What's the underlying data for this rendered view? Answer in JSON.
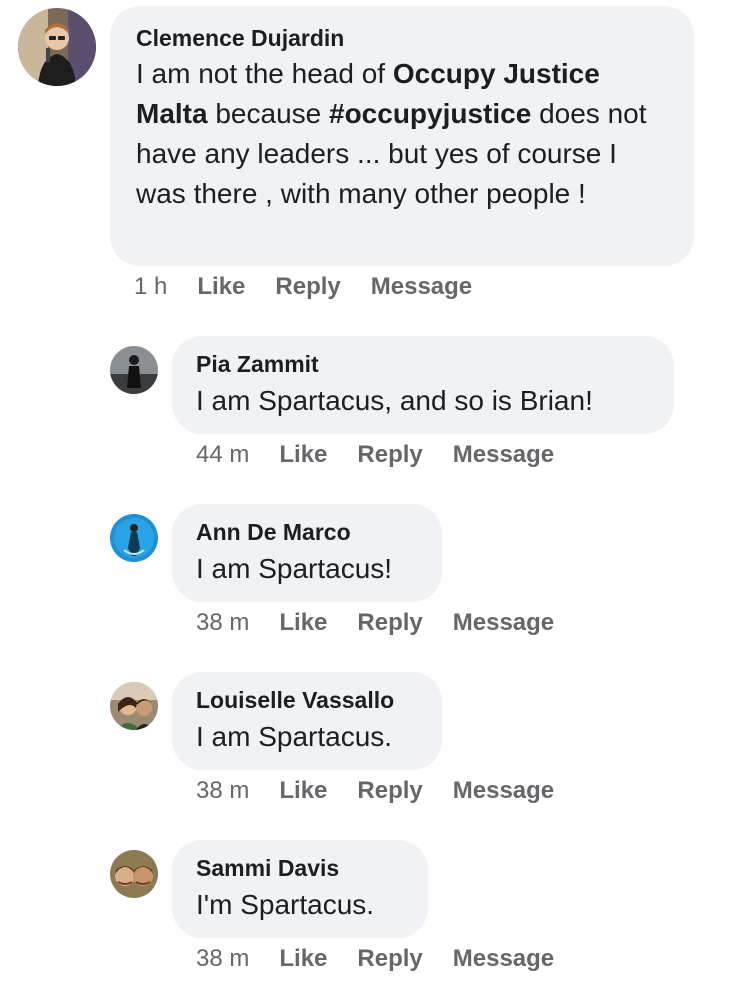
{
  "comments": [
    {
      "author": "Clemence Dujardin",
      "text_parts": [
        {
          "t": "I am not the head of ",
          "b": false
        },
        {
          "t": "Occupy Justice Malta",
          "b": true
        },
        {
          "t": " because ",
          "b": false
        },
        {
          "t": "#occupyjustice",
          "b": true
        },
        {
          "t": " does not have any leaders ... but yes of course I was there , with many other people !",
          "b": false
        }
      ],
      "time": "1 h",
      "like": "Like",
      "reply": "Reply",
      "message": "Message"
    },
    {
      "author": "Pia Zammit",
      "text": "I am Spartacus, and so is Brian!",
      "time": "44 m",
      "like": "Like",
      "reply": "Reply",
      "message": "Message"
    },
    {
      "author": "Ann De Marco",
      "text": "I am Spartacus!",
      "time": "38 m",
      "like": "Like",
      "reply": "Reply",
      "message": "Message"
    },
    {
      "author": "Louiselle Vassallo",
      "text": "I am Spartacus.",
      "time": "38 m",
      "like": "Like",
      "reply": "Reply",
      "message": "Message"
    },
    {
      "author": "Sammi Davis",
      "text": "I'm Spartacus.",
      "time": "38 m",
      "like": "Like",
      "reply": "Reply",
      "message": "Message"
    }
  ]
}
